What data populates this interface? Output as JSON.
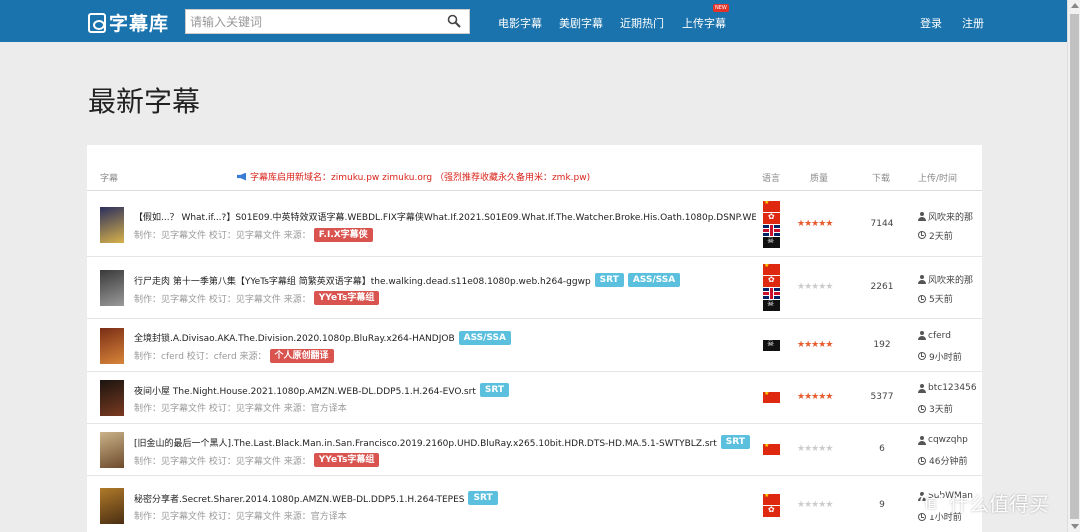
{
  "header": {
    "logo_text": "字幕库",
    "search_placeholder": "请输入关键词",
    "nav": [
      "电影字幕",
      "美剧字幕",
      "近期热门",
      "上传字幕"
    ],
    "new_badge": "NEW",
    "login": "登录",
    "register": "注册"
  },
  "page_title": "最新字幕",
  "table": {
    "col_subtitle": "字幕",
    "notice": "字幕库启用新域名：zimuku.pw zimuku.org （强烈推荐收藏永久备用米：zmk.pw)",
    "col_language": "语言",
    "col_quality": "质量",
    "col_downloads": "下载",
    "col_uploader": "上传/时间",
    "rows": [
      {
        "title": "【假如...？ What.if...?】S01E09.中英特效双语字幕.WEBDL.FIX字幕侠What.If.2021.S01E09.What.If.The.Watcher.Broke.His.Oath.1080p.DSNP.WEB",
        "formats": [],
        "meta": "制作：见字幕文件 校订：见字幕文件 来源：",
        "source_label": "F.I.X字幕侠",
        "flags": [
          "cn",
          "hk",
          "uk",
          "pirate"
        ],
        "stars": 5,
        "downloads": "7144",
        "uploader": "风吹来的那",
        "time": "2天前"
      },
      {
        "title": "行尸走肉 第十一季第八集【YYeTs字幕组 简繁英双语字幕】the.walking.dead.s11e08.1080p.web.h264-ggwp",
        "formats": [
          "SRT",
          "ASS/SSA"
        ],
        "meta": "制作：见字幕文件 校订：见字幕文件 来源：",
        "source_label": "YYeTs字幕组",
        "flags": [
          "cn",
          "hk",
          "uk",
          "pirate"
        ],
        "stars": 0,
        "downloads": "2261",
        "uploader": "风吹来的那",
        "time": "5天前"
      },
      {
        "title": "全境封锁.A.Divisao.AKA.The.Division.2020.1080p.BluRay.x264-HANDJOB",
        "formats": [
          "ASS/SSA"
        ],
        "meta": "制作：cferd 校订：cferd 来源：",
        "source_label": "个人原创翻译",
        "flags": [
          "pirate"
        ],
        "stars": 5,
        "downloads": "192",
        "uploader": "cferd",
        "time": "9小时前"
      },
      {
        "title": "夜间小屋 The.Night.House.2021.1080p.AMZN.WEB-DL.DDP5.1.H.264-EVO.srt",
        "formats": [
          "SRT"
        ],
        "meta": "制作：见字幕文件 校订：见字幕文件 来源：官方译本",
        "source_label": "",
        "flags": [
          "cn"
        ],
        "stars": 5,
        "downloads": "5377",
        "uploader": "btc123456",
        "time": "3天前"
      },
      {
        "title": "[旧金山的最后一个黑人].The.Last.Black.Man.in.San.Francisco.2019.2160p.UHD.BluRay.x265.10bit.HDR.DTS-HD.MA.5.1-SWTYBLZ.srt",
        "formats": [
          "SRT"
        ],
        "meta": "制作：见字幕文件 校订：见字幕文件 来源：",
        "source_label": "YYeTs字幕组",
        "flags": [
          "cn"
        ],
        "stars": 0,
        "downloads": "6",
        "uploader": "cqwzqhp",
        "time": "46分钟前"
      },
      {
        "title": "秘密分享者.Secret.Sharer.2014.1080p.AMZN.WEB-DL.DDP5.1.H.264-TEPES",
        "formats": [
          "SRT"
        ],
        "meta": "制作：见字幕文件 校订：见字幕文件 来源：官方译本",
        "source_label": "",
        "flags": [
          "cn",
          "hk"
        ],
        "stars": 0,
        "downloads": "9",
        "uploader": "SubWMan",
        "time": "1小时前"
      }
    ]
  },
  "watermark": "什么值得买"
}
